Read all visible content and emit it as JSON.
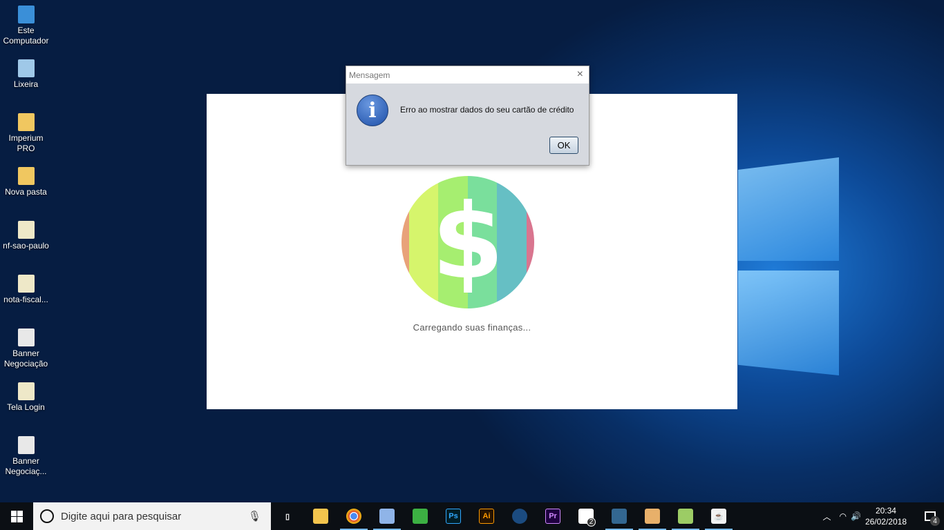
{
  "desktop_icons": [
    {
      "label": "Este Computador",
      "icon": "computer-icon"
    },
    {
      "label": "Lixeira",
      "icon": "recycle-bin-icon"
    },
    {
      "label": "Imperium PRO",
      "icon": "folder-icon"
    },
    {
      "label": "Nova pasta",
      "icon": "folder-icon"
    },
    {
      "label": "nf-sao-paulo",
      "icon": "image-file-icon"
    },
    {
      "label": "nota-fiscal...",
      "icon": "image-file-icon"
    },
    {
      "label": "Banner Negociação",
      "icon": "pdf-icon"
    },
    {
      "label": "Tela Login",
      "icon": "image-file-icon"
    },
    {
      "label": "Banner Negociaç...",
      "icon": "pdf-icon"
    }
  ],
  "splash": {
    "loading_text": "Carregando suas finanças...",
    "stripe_colors": [
      "#e8a27a",
      "#d6f56c",
      "#a6ee70",
      "#7adf9c",
      "#66bfc4",
      "#d9758f"
    ]
  },
  "dialog": {
    "title": "Mensagem",
    "message": "Erro ao mostrar dados do seu cartão de crédito",
    "ok_label": "OK",
    "close": "×"
  },
  "taskbar": {
    "search_placeholder": "Digite aqui para pesquisar",
    "apps": [
      {
        "name": "task-view",
        "badge": ""
      },
      {
        "name": "file-explorer",
        "badge": ""
      },
      {
        "name": "chrome",
        "badge": ""
      },
      {
        "name": "virtualbox",
        "badge": ""
      },
      {
        "name": "terminal-app",
        "badge": ""
      },
      {
        "name": "photoshop",
        "label": "Ps",
        "badge": ""
      },
      {
        "name": "illustrator",
        "label": "Ai",
        "badge": ""
      },
      {
        "name": "steam",
        "badge": ""
      },
      {
        "name": "premiere",
        "label": "Pr",
        "badge": ""
      },
      {
        "name": "mail",
        "badge": "2"
      },
      {
        "name": "postgresql",
        "badge": ""
      },
      {
        "name": "paint",
        "badge": ""
      },
      {
        "name": "notepad",
        "badge": ""
      },
      {
        "name": "java",
        "badge": ""
      }
    ],
    "time": "20:34",
    "date": "26/02/2018",
    "notifications": "4"
  }
}
